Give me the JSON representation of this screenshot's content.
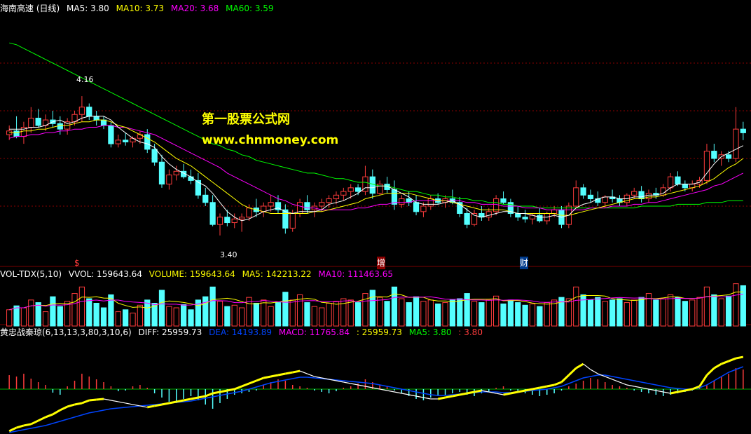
{
  "price_panel": {
    "name": "海南高速 (日线)",
    "ma5": "MA5: 3.80",
    "ma10": "MA10: 3.73",
    "ma20": "MA20: 3.68",
    "ma60": "MA60: 3.59",
    "high_label": "4.16",
    "low_label": "3.40",
    "markers": [
      "$",
      "增",
      "财"
    ],
    "watermark_title": "第一股票公式网",
    "watermark_url": "www.chnmoney.com"
  },
  "volume_panel": {
    "name": "VOL-TDX(5,10)",
    "vvol": "VVOL: 159643.64",
    "volume": "VOLUME: 159643.64",
    "ma5": "MA5: 142213.22",
    "ma10": "MA10: 111463.65"
  },
  "macd_panel": {
    "name": "黄忠战秦琼(6,13,13,3,80,3,10,6)",
    "diff": "DIFF: 25959.73",
    "dea": "DEA: 14193.89",
    "macd": "MACD: 11765.84",
    "extra1": ": 25959.73",
    "ma5": "MA5: 3.80",
    "extra2": ": 3.80"
  },
  "colors": {
    "up": "#ff3c3c",
    "down": "#54ffff",
    "ma5": "#ffffff",
    "ma10": "#ffff00",
    "ma20": "#ff00ff",
    "ma60": "#00ff00",
    "macd_dea": "#0044ff",
    "grid": "#8b0000"
  },
  "chart_data": {
    "type": "candlestick",
    "price_ylim": [
      3.3,
      4.6
    ],
    "candles": [
      [
        3.95,
        4.0,
        3.92,
        3.97
      ],
      [
        3.97,
        4.05,
        3.93,
        3.94
      ],
      [
        3.94,
        4.02,
        3.9,
        3.99
      ],
      [
        3.99,
        4.1,
        3.96,
        4.04
      ],
      [
        4.04,
        4.09,
        3.99,
        4.0
      ],
      [
        4.0,
        4.06,
        3.97,
        4.03
      ],
      [
        4.03,
        4.08,
        3.99,
        4.01
      ],
      [
        4.01,
        4.05,
        3.95,
        3.98
      ],
      [
        3.98,
        4.04,
        3.95,
        4.02
      ],
      [
        4.02,
        4.08,
        4.0,
        4.06
      ],
      [
        4.06,
        4.16,
        4.02,
        4.1
      ],
      [
        4.1,
        4.12,
        4.03,
        4.05
      ],
      [
        4.05,
        4.08,
        4.0,
        4.03
      ],
      [
        4.03,
        4.05,
        3.98,
        4.0
      ],
      [
        4.0,
        4.02,
        3.88,
        3.9
      ],
      [
        3.9,
        3.95,
        3.88,
        3.92
      ],
      [
        3.92,
        3.96,
        3.89,
        3.91
      ],
      [
        3.91,
        3.94,
        3.88,
        3.93
      ],
      [
        3.93,
        3.97,
        3.9,
        3.95
      ],
      [
        3.95,
        3.98,
        3.85,
        3.87
      ],
      [
        3.87,
        3.9,
        3.78,
        3.8
      ],
      [
        3.8,
        3.84,
        3.66,
        3.68
      ],
      [
        3.68,
        3.76,
        3.65,
        3.73
      ],
      [
        3.73,
        3.78,
        3.7,
        3.75
      ],
      [
        3.75,
        3.79,
        3.71,
        3.72
      ],
      [
        3.72,
        3.76,
        3.68,
        3.7
      ],
      [
        3.7,
        3.74,
        3.6,
        3.62
      ],
      [
        3.62,
        3.66,
        3.56,
        3.58
      ],
      [
        3.58,
        3.62,
        3.45,
        3.46
      ],
      [
        3.46,
        3.52,
        3.4,
        3.5
      ],
      [
        3.5,
        3.54,
        3.45,
        3.47
      ],
      [
        3.47,
        3.52,
        3.44,
        3.49
      ],
      [
        3.49,
        3.52,
        3.42,
        3.5
      ],
      [
        3.5,
        3.57,
        3.48,
        3.55
      ],
      [
        3.55,
        3.6,
        3.5,
        3.53
      ],
      [
        3.53,
        3.58,
        3.5,
        3.56
      ],
      [
        3.56,
        3.62,
        3.53,
        3.58
      ],
      [
        3.58,
        3.62,
        3.52,
        3.54
      ],
      [
        3.54,
        3.57,
        3.41,
        3.44
      ],
      [
        3.44,
        3.54,
        3.42,
        3.52
      ],
      [
        3.52,
        3.6,
        3.5,
        3.58
      ],
      [
        3.58,
        3.62,
        3.52,
        3.54
      ],
      [
        3.54,
        3.58,
        3.5,
        3.56
      ],
      [
        3.56,
        3.6,
        3.53,
        3.58
      ],
      [
        3.58,
        3.62,
        3.55,
        3.6
      ],
      [
        3.6,
        3.64,
        3.57,
        3.62
      ],
      [
        3.62,
        3.66,
        3.59,
        3.64
      ],
      [
        3.64,
        3.68,
        3.6,
        3.66
      ],
      [
        3.66,
        3.68,
        3.62,
        3.64
      ],
      [
        3.64,
        3.78,
        3.62,
        3.72
      ],
      [
        3.72,
        3.76,
        3.6,
        3.63
      ],
      [
        3.63,
        3.7,
        3.62,
        3.68
      ],
      [
        3.68,
        3.72,
        3.63,
        3.65
      ],
      [
        3.65,
        3.7,
        3.54,
        3.57
      ],
      [
        3.57,
        3.62,
        3.55,
        3.6
      ],
      [
        3.6,
        3.64,
        3.56,
        3.58
      ],
      [
        3.58,
        3.62,
        3.51,
        3.53
      ],
      [
        3.53,
        3.58,
        3.5,
        3.56
      ],
      [
        3.56,
        3.62,
        3.54,
        3.6
      ],
      [
        3.6,
        3.63,
        3.57,
        3.58
      ],
      [
        3.58,
        3.62,
        3.55,
        3.6
      ],
      [
        3.6,
        3.65,
        3.57,
        3.58
      ],
      [
        3.58,
        3.61,
        3.5,
        3.52
      ],
      [
        3.52,
        3.55,
        3.44,
        3.46
      ],
      [
        3.46,
        3.54,
        3.45,
        3.52
      ],
      [
        3.52,
        3.56,
        3.48,
        3.5
      ],
      [
        3.5,
        3.55,
        3.48,
        3.53
      ],
      [
        3.53,
        3.62,
        3.51,
        3.6
      ],
      [
        3.6,
        3.64,
        3.57,
        3.58
      ],
      [
        3.58,
        3.6,
        3.5,
        3.52
      ],
      [
        3.52,
        3.56,
        3.48,
        3.5
      ],
      [
        3.5,
        3.54,
        3.47,
        3.49
      ],
      [
        3.49,
        3.52,
        3.46,
        3.51
      ],
      [
        3.51,
        3.55,
        3.47,
        3.48
      ],
      [
        3.48,
        3.53,
        3.46,
        3.52
      ],
      [
        3.52,
        3.56,
        3.5,
        3.54
      ],
      [
        3.54,
        3.56,
        3.44,
        3.46
      ],
      [
        3.46,
        3.58,
        3.44,
        3.56
      ],
      [
        3.56,
        3.7,
        3.55,
        3.66
      ],
      [
        3.66,
        3.68,
        3.6,
        3.62
      ],
      [
        3.62,
        3.65,
        3.58,
        3.6
      ],
      [
        3.6,
        3.64,
        3.56,
        3.58
      ],
      [
        3.58,
        3.62,
        3.55,
        3.61
      ],
      [
        3.61,
        3.65,
        3.58,
        3.6
      ],
      [
        3.6,
        3.62,
        3.56,
        3.58
      ],
      [
        3.58,
        3.63,
        3.56,
        3.62
      ],
      [
        3.62,
        3.66,
        3.6,
        3.64
      ],
      [
        3.64,
        3.67,
        3.58,
        3.6
      ],
      [
        3.6,
        3.65,
        3.58,
        3.63
      ],
      [
        3.63,
        3.66,
        3.6,
        3.62
      ],
      [
        3.62,
        3.68,
        3.61,
        3.66
      ],
      [
        3.66,
        3.74,
        3.64,
        3.72
      ],
      [
        3.72,
        3.75,
        3.67,
        3.68
      ],
      [
        3.68,
        3.7,
        3.64,
        3.66
      ],
      [
        3.66,
        3.7,
        3.64,
        3.68
      ],
      [
        3.68,
        3.72,
        3.66,
        3.7
      ],
      [
        3.7,
        3.9,
        3.68,
        3.86
      ],
      [
        3.86,
        3.9,
        3.8,
        3.82
      ],
      [
        3.82,
        3.86,
        3.78,
        3.84
      ],
      [
        3.84,
        3.86,
        3.8,
        3.82
      ],
      [
        3.82,
        4.1,
        3.8,
        3.98
      ],
      [
        3.98,
        4.02,
        3.92,
        3.96
      ]
    ],
    "ma5": [
      3.98,
      3.98,
      3.98,
      3.99,
      3.99,
      4.0,
      4.02,
      4.03,
      4.01,
      4.02,
      4.04,
      4.05,
      4.05,
      4.05,
      4.03,
      3.99,
      3.96,
      3.93,
      3.91,
      3.9,
      3.88,
      3.83,
      3.79,
      3.76,
      3.74,
      3.72,
      3.69,
      3.67,
      3.63,
      3.58,
      3.53,
      3.5,
      3.48,
      3.49,
      3.51,
      3.53,
      3.54,
      3.55,
      3.53,
      3.52,
      3.53,
      3.53,
      3.53,
      3.54,
      3.57,
      3.58,
      3.59,
      3.61,
      3.63,
      3.66,
      3.66,
      3.67,
      3.67,
      3.65,
      3.63,
      3.61,
      3.58,
      3.57,
      3.57,
      3.57,
      3.58,
      3.59,
      3.57,
      3.54,
      3.51,
      3.5,
      3.51,
      3.52,
      3.53,
      3.53,
      3.52,
      3.52,
      3.51,
      3.5,
      3.5,
      3.51,
      3.5,
      3.51,
      3.55,
      3.57,
      3.58,
      3.6,
      3.61,
      3.61,
      3.6,
      3.6,
      3.61,
      3.61,
      3.62,
      3.62,
      3.63,
      3.66,
      3.68,
      3.68,
      3.68,
      3.69,
      3.74,
      3.79,
      3.83,
      3.85,
      3.87,
      3.89
    ],
    "ma10": [
      3.96,
      3.96,
      3.97,
      3.97,
      3.98,
      3.98,
      3.99,
      4.0,
      4.0,
      4.01,
      4.02,
      4.02,
      4.03,
      4.03,
      4.02,
      4.0,
      3.99,
      3.97,
      3.95,
      3.93,
      3.91,
      3.88,
      3.85,
      3.82,
      3.8,
      3.78,
      3.75,
      3.72,
      3.69,
      3.66,
      3.63,
      3.6,
      3.57,
      3.55,
      3.54,
      3.53,
      3.52,
      3.52,
      3.52,
      3.52,
      3.52,
      3.52,
      3.53,
      3.53,
      3.54,
      3.55,
      3.56,
      3.57,
      3.58,
      3.6,
      3.61,
      3.62,
      3.63,
      3.63,
      3.63,
      3.63,
      3.62,
      3.61,
      3.6,
      3.59,
      3.59,
      3.58,
      3.57,
      3.56,
      3.55,
      3.54,
      3.54,
      3.54,
      3.54,
      3.53,
      3.52,
      3.52,
      3.52,
      3.52,
      3.52,
      3.52,
      3.51,
      3.51,
      3.52,
      3.53,
      3.54,
      3.55,
      3.56,
      3.57,
      3.58,
      3.59,
      3.6,
      3.6,
      3.61,
      3.61,
      3.62,
      3.63,
      3.64,
      3.65,
      3.66,
      3.67,
      3.69,
      3.71,
      3.74,
      3.77,
      3.79,
      3.82
    ],
    "ma20": [
      3.93,
      3.94,
      3.94,
      3.95,
      3.95,
      3.96,
      3.96,
      3.97,
      3.97,
      3.98,
      3.98,
      3.99,
      3.99,
      4.0,
      4.0,
      3.99,
      3.99,
      3.98,
      3.97,
      3.96,
      3.95,
      3.93,
      3.91,
      3.89,
      3.87,
      3.85,
      3.83,
      3.81,
      3.79,
      3.77,
      3.74,
      3.72,
      3.7,
      3.68,
      3.66,
      3.64,
      3.62,
      3.6,
      3.59,
      3.57,
      3.56,
      3.55,
      3.55,
      3.54,
      3.54,
      3.54,
      3.54,
      3.54,
      3.55,
      3.55,
      3.56,
      3.57,
      3.57,
      3.58,
      3.58,
      3.58,
      3.59,
      3.59,
      3.59,
      3.59,
      3.59,
      3.59,
      3.59,
      3.58,
      3.58,
      3.57,
      3.57,
      3.57,
      3.56,
      3.56,
      3.56,
      3.55,
      3.55,
      3.55,
      3.54,
      3.54,
      3.54,
      3.54,
      3.54,
      3.54,
      3.55,
      3.55,
      3.55,
      3.56,
      3.56,
      3.56,
      3.57,
      3.57,
      3.58,
      3.58,
      3.59,
      3.6,
      3.61,
      3.62,
      3.63,
      3.64,
      3.65,
      3.67,
      3.68,
      3.7,
      3.72,
      3.74
    ],
    "ma60": [
      4.45,
      4.44,
      4.42,
      4.4,
      4.38,
      4.36,
      4.34,
      4.32,
      4.3,
      4.28,
      4.26,
      4.24,
      4.22,
      4.2,
      4.18,
      4.16,
      4.14,
      4.12,
      4.1,
      4.08,
      4.06,
      4.04,
      4.02,
      4.0,
      3.98,
      3.96,
      3.94,
      3.92,
      3.9,
      3.89,
      3.87,
      3.86,
      3.84,
      3.83,
      3.81,
      3.8,
      3.79,
      3.78,
      3.77,
      3.76,
      3.75,
      3.74,
      3.74,
      3.73,
      3.72,
      3.71,
      3.71,
      3.7,
      3.69,
      3.69,
      3.68,
      3.67,
      3.67,
      3.66,
      3.65,
      3.64,
      3.64,
      3.63,
      3.62,
      3.62,
      3.61,
      3.61,
      3.6,
      3.6,
      3.59,
      3.59,
      3.58,
      3.58,
      3.57,
      3.57,
      3.56,
      3.56,
      3.56,
      3.55,
      3.55,
      3.55,
      3.55,
      3.55,
      3.55,
      3.55,
      3.55,
      3.55,
      3.55,
      3.55,
      3.55,
      3.55,
      3.55,
      3.56,
      3.56,
      3.56,
      3.56,
      3.56,
      3.57,
      3.57,
      3.57,
      3.57,
      3.58,
      3.58,
      3.58,
      3.59,
      3.59,
      3.59
    ],
    "volume": [
      25,
      31,
      28,
      40,
      36,
      22,
      45,
      30,
      38,
      50,
      60,
      42,
      35,
      28,
      48,
      22,
      25,
      20,
      32,
      40,
      35,
      55,
      30,
      28,
      33,
      25,
      40,
      45,
      60,
      38,
      30,
      32,
      28,
      44,
      35,
      40,
      30,
      36,
      52,
      40,
      48,
      36,
      30,
      28,
      35,
      38,
      42,
      40,
      36,
      50,
      55,
      44,
      38,
      60,
      42,
      36,
      45,
      38,
      40,
      34,
      36,
      40,
      42,
      50,
      38,
      36,
      40,
      46,
      34,
      40,
      36,
      32,
      34,
      30,
      36,
      40,
      44,
      42,
      60,
      48,
      40,
      44,
      38,
      40,
      42,
      36,
      40,
      44,
      50,
      40,
      42,
      48,
      44,
      38,
      40,
      44,
      60,
      48,
      42,
      46,
      65,
      62
    ],
    "vol_ylim": [
      0,
      70
    ],
    "macd_hist": [
      20,
      18,
      22,
      15,
      10,
      6,
      -5,
      -8,
      4,
      12,
      22,
      18,
      14,
      10,
      4,
      -3,
      -2,
      4,
      6,
      2,
      -6,
      -12,
      -18,
      -20,
      -14,
      -10,
      -16,
      -22,
      -28,
      -20,
      -14,
      -8,
      -6,
      -4,
      -2,
      6,
      10,
      14,
      12,
      6,
      4,
      2,
      -2,
      -4,
      -6,
      -3,
      2,
      4,
      8,
      14,
      10,
      6,
      4,
      -2,
      -6,
      -10,
      -14,
      -16,
      -12,
      -10,
      -8,
      -6,
      -4,
      -8,
      -10,
      -6,
      -4,
      2,
      4,
      -2,
      -4,
      -6,
      -8,
      -10,
      -8,
      -6,
      -2,
      4,
      8,
      12,
      16,
      14,
      10,
      6,
      4,
      2,
      -2,
      -4,
      -6,
      -8,
      -10,
      -8,
      -6,
      -4,
      -2,
      2,
      6,
      12,
      18,
      22,
      30,
      28
    ],
    "macd_diff": [
      -60,
      -55,
      -52,
      -50,
      -45,
      -40,
      -36,
      -30,
      -25,
      -22,
      -20,
      -16,
      -15,
      -14,
      -16,
      -18,
      -20,
      -22,
      -24,
      -26,
      -24,
      -22,
      -20,
      -18,
      -16,
      -14,
      -12,
      -10,
      -6,
      -4,
      -2,
      0,
      4,
      8,
      12,
      16,
      18,
      20,
      22,
      24,
      26,
      22,
      18,
      16,
      14,
      12,
      10,
      8,
      6,
      4,
      2,
      0,
      -2,
      -4,
      -6,
      -8,
      -10,
      -12,
      -14,
      -14,
      -12,
      -10,
      -8,
      -6,
      -4,
      -2,
      -4,
      -6,
      -8,
      -6,
      -4,
      -2,
      0,
      2,
      4,
      6,
      10,
      20,
      30,
      36,
      28,
      22,
      18,
      14,
      10,
      6,
      4,
      2,
      0,
      -2,
      -4,
      -6,
      -4,
      -2,
      0,
      4,
      20,
      30,
      36,
      40,
      44,
      46
    ],
    "macd_dea": [
      -62,
      -60,
      -58,
      -56,
      -54,
      -52,
      -49,
      -46,
      -43,
      -40,
      -37,
      -34,
      -32,
      -30,
      -28,
      -27,
      -26,
      -25,
      -24,
      -23,
      -22,
      -21,
      -20,
      -19,
      -18,
      -17,
      -15,
      -13,
      -11,
      -9,
      -7,
      -5,
      -3,
      0,
      3,
      6,
      9,
      11,
      13,
      15,
      17,
      17,
      16,
      15,
      14,
      13,
      12,
      11,
      10,
      9,
      8,
      6,
      4,
      2,
      0,
      -2,
      -4,
      -6,
      -8,
      -9,
      -9,
      -8,
      -7,
      -6,
      -5,
      -4,
      -4,
      -4,
      -5,
      -5,
      -4,
      -3,
      -2,
      -1,
      0,
      2,
      4,
      8,
      12,
      16,
      18,
      20,
      20,
      18,
      16,
      14,
      12,
      10,
      8,
      6,
      4,
      2,
      1,
      0,
      0,
      2,
      6,
      12,
      18,
      24,
      28,
      32
    ]
  }
}
